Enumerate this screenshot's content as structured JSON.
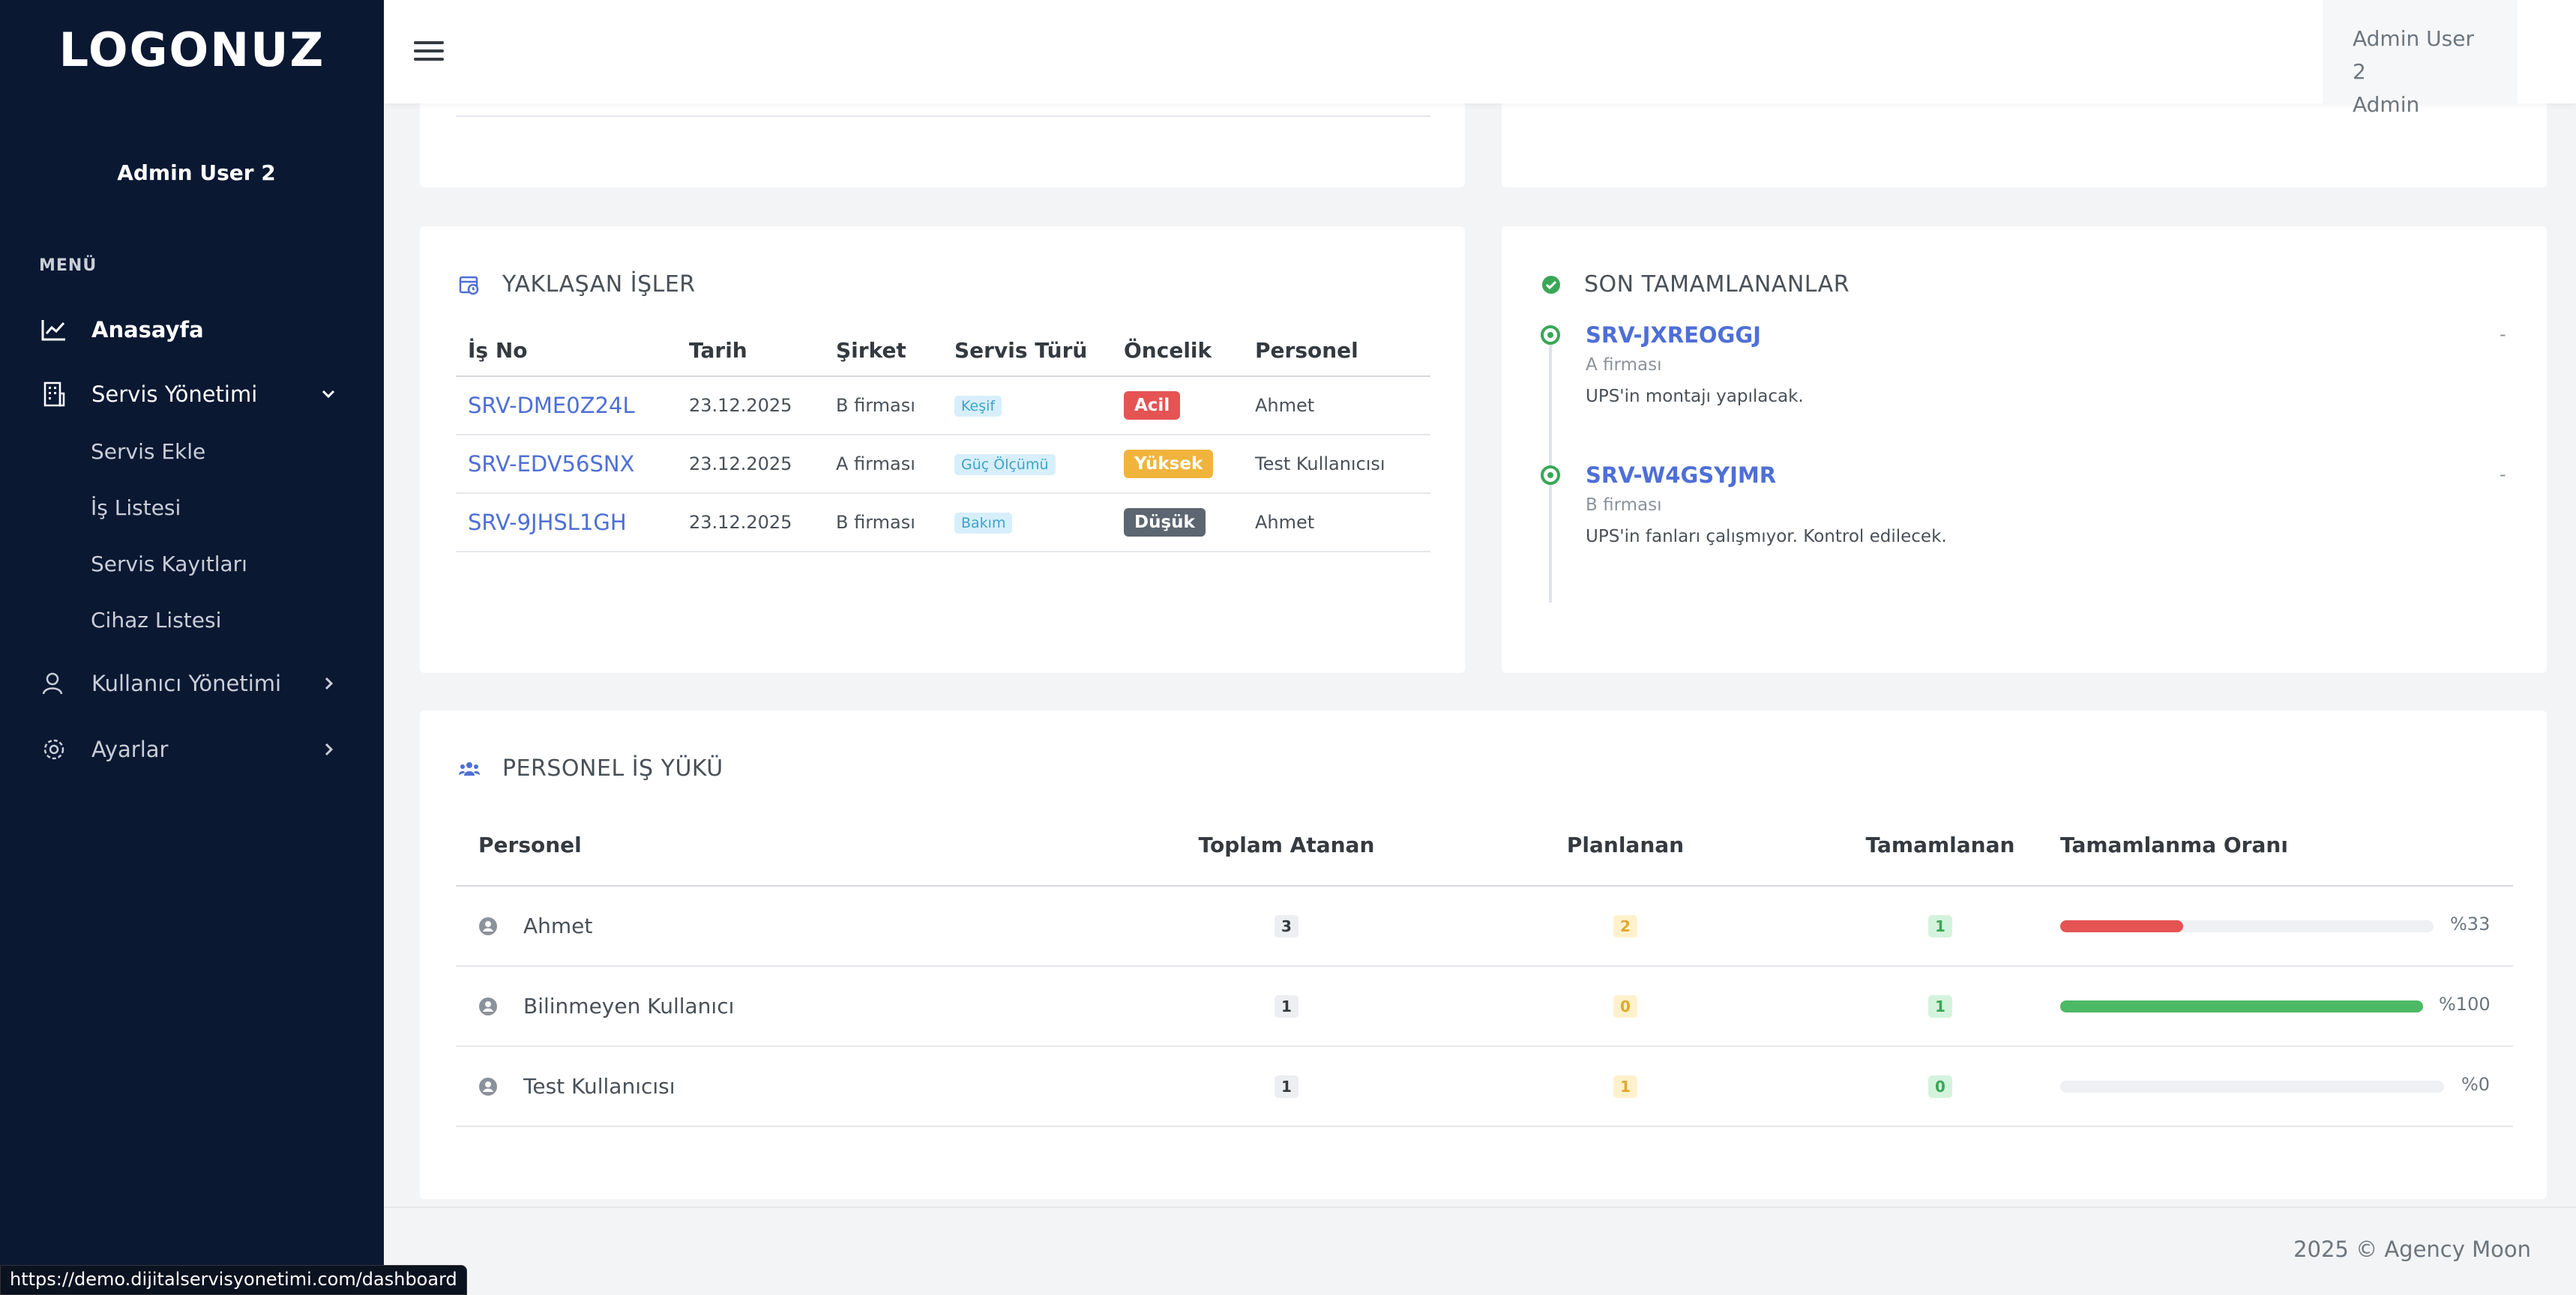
{
  "brand": {
    "logo": "LOGONUZ"
  },
  "sidebar": {
    "user_name": "Admin User 2",
    "menu_title": "MENÜ",
    "items": [
      {
        "label": "Anasayfa",
        "icon": "chart-line-icon"
      },
      {
        "label": "Servis Yönetimi",
        "icon": "building-icon"
      },
      {
        "label": "Kullanıcı Yönetimi",
        "icon": "user-icon"
      },
      {
        "label": "Ayarlar",
        "icon": "gear-icon"
      }
    ],
    "subitems": [
      {
        "label": "Servis Ekle"
      },
      {
        "label": "İş Listesi"
      },
      {
        "label": "Servis Kayıtları"
      },
      {
        "label": "Cihaz Listesi"
      }
    ]
  },
  "header": {
    "user_name": "Admin User 2",
    "user_role": "Admin"
  },
  "upcoming": {
    "title": "YAKLAŞAN İŞLER",
    "columns": [
      "İş No",
      "Tarih",
      "Şirket",
      "Servis Türü",
      "Öncelik",
      "Personel"
    ],
    "rows": [
      {
        "job_no": "SRV-DME0Z24L",
        "date": "23.12.2025",
        "company": "B firması",
        "service_type": "Keşif",
        "priority": "Acil",
        "priority_color": "#e55353",
        "staff": "Ahmet"
      },
      {
        "job_no": "SRV-EDV56SNX",
        "date": "23.12.2025",
        "company": "A firması",
        "service_type": "Güç Ölçümü",
        "priority": "Yüksek",
        "priority_color": "#f0b43c",
        "staff": "Test Kullanıcısı"
      },
      {
        "job_no": "SRV-9JHSL1GH",
        "date": "23.12.2025",
        "company": "B firması",
        "service_type": "Bakım",
        "priority": "Düşük",
        "priority_color": "#5c6670",
        "staff": "Ahmet"
      }
    ]
  },
  "completed": {
    "title": "SON TAMAMLANANLAR",
    "items": [
      {
        "job_no": "SRV-JXREOGGJ",
        "company": "A firması",
        "description": "UPS'in montajı yapılacak.",
        "right": "-"
      },
      {
        "job_no": "SRV-W4GSYJMR",
        "company": "B firması",
        "description": "UPS'in fanları çalışmıyor. Kontrol edilecek.",
        "right": "-"
      }
    ]
  },
  "workload": {
    "title": "PERSONEL İŞ YÜKÜ",
    "columns": [
      "Personel",
      "Toplam Atanan",
      "Planlanan",
      "Tamamlanan",
      "Tamamlanma Oranı"
    ],
    "rows": [
      {
        "name": "Ahmet",
        "total": "3",
        "planned": "2",
        "completed": "1",
        "rate_label": "%33",
        "rate": 0.33,
        "bar_color": "#e55353"
      },
      {
        "name": "Bilinmeyen Kullanıcı",
        "total": "1",
        "planned": "0",
        "completed": "1",
        "rate_label": "%100",
        "rate": 1.0,
        "bar_color": "#4cb964"
      },
      {
        "name": "Test Kullanıcısı",
        "total": "1",
        "planned": "1",
        "completed": "0",
        "rate_label": "%0",
        "rate": 0.0,
        "bar_color": "#4cb964"
      }
    ]
  },
  "footer": {
    "text": "2025 © Agency Moon"
  },
  "status_bar": {
    "url": "https://demo.dijitalservisyonetimi.com/dashboard"
  }
}
